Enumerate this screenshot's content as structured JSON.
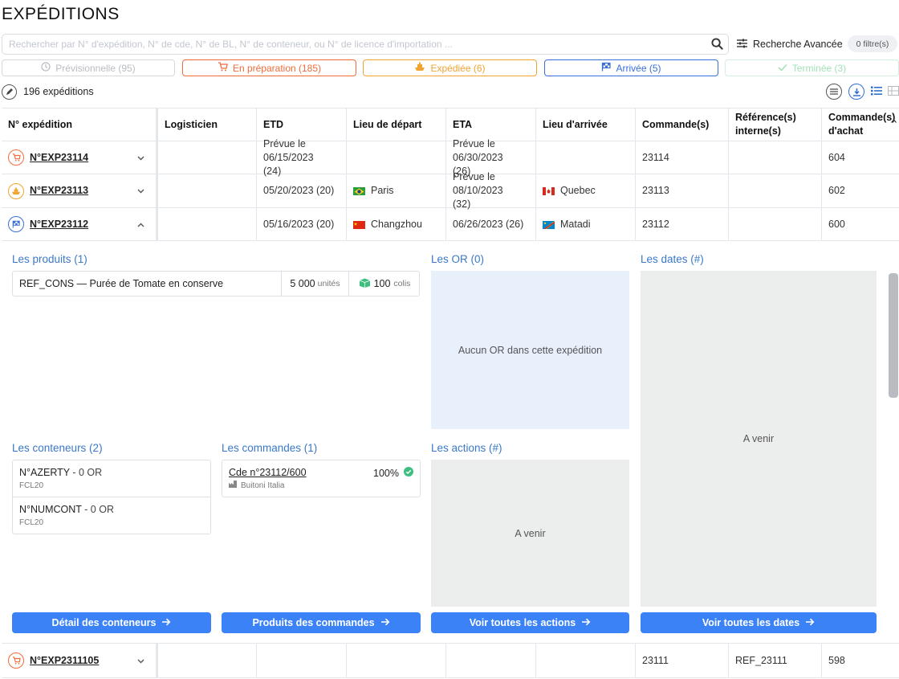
{
  "page": {
    "title": "EXPÉDITIONS"
  },
  "search": {
    "placeholder": "Rechercher par N° d'expédition, N° de cde, N° de BL, N° de conteneur, ou N° de licence d'importation ...",
    "advanced_label": "Recherche Avancée",
    "filter_badge": "0 filtre(s)"
  },
  "status_tabs": [
    {
      "label": "Prévisionnelle (95)",
      "color": "#b9bcc2",
      "icon": "clock-icon"
    },
    {
      "label": "En préparation (185)",
      "color": "#ef6c3a",
      "icon": "cart-icon"
    },
    {
      "label": "Expédiée (6)",
      "color": "#f0a431",
      "icon": "ship-icon"
    },
    {
      "label": "Arrivée (5)",
      "color": "#3a6fd8",
      "icon": "flag-icon"
    },
    {
      "label": "Terminée (3)",
      "color": "#a5dfb9",
      "icon": "check-icon"
    }
  ],
  "summary": {
    "count_label": "196 expéditions"
  },
  "table": {
    "headers": [
      "N° expédition",
      "Logisticien",
      "ETD",
      "Lieu de départ",
      "ETA",
      "Lieu d'arrivée",
      "Commande(s)",
      "Référence(s) interne(s)",
      "Commande(s) d'achat"
    ],
    "rows": [
      {
        "exp": "N°EXP23114",
        "status_icon": "cart-icon",
        "status_color": "#ef6c3a",
        "logisticien": "",
        "etd": "Prévue le 06/15/2023 (24)",
        "depart": "",
        "depart_flag": "",
        "eta": "Prévue le 06/30/2023 (26)",
        "arrivee": "",
        "arrivee_flag": "",
        "commandes": "23114",
        "ref": "",
        "achat": "604",
        "expanded": false
      },
      {
        "exp": "N°EXP23113",
        "status_icon": "ship-icon",
        "status_color": "#f0a431",
        "logisticien": "",
        "etd": "05/20/2023 (20)",
        "depart": "Paris",
        "depart_flag": "brazil-flag",
        "eta": "Prévue le 08/10/2023 (32)",
        "arrivee": "Quebec",
        "arrivee_flag": "canada-flag",
        "commandes": "23113",
        "ref": "",
        "achat": "602",
        "expanded": false
      },
      {
        "exp": "N°EXP23112",
        "status_icon": "flag-icon",
        "status_color": "#3a6fd8",
        "logisticien": "",
        "etd": "05/16/2023 (20)",
        "depart": "Changzhou",
        "depart_flag": "china-flag",
        "eta": "06/26/2023 (26)",
        "arrivee": "Matadi",
        "arrivee_flag": "drc-flag",
        "commandes": "23112",
        "ref": "",
        "achat": "600",
        "expanded": true
      },
      {
        "exp": "N°EXP2311105",
        "status_icon": "cart-icon",
        "status_color": "#ef6c3a",
        "logisticien": "",
        "etd": "",
        "depart": "",
        "depart_flag": "",
        "eta": "",
        "arrivee": "",
        "arrivee_flag": "",
        "commandes": "23111",
        "ref": "REF_23111",
        "achat": "598",
        "expanded": false
      }
    ]
  },
  "detail": {
    "produits": {
      "title": "Les produits (1)",
      "items": [
        {
          "name": "REF_CONS — Purée de Tomate en conserve",
          "qty": "5 000",
          "qty_unit": "unités",
          "colis": "100",
          "colis_unit": "colis"
        }
      ]
    },
    "or": {
      "title": "Les OR (0)",
      "empty": "Aucun OR dans cette expédition"
    },
    "dates": {
      "title": "Les dates (#)",
      "placeholder": "A venir"
    },
    "conteneurs": {
      "title": "Les conteneurs (2)",
      "items": [
        {
          "name": "N°AZERTY",
          "or": " - 0 OR",
          "type": "FCL20"
        },
        {
          "name": "N°NUMCONT",
          "or": " - 0 OR",
          "type": "FCL20"
        }
      ]
    },
    "commandes": {
      "title": "Les commandes (1)",
      "items": [
        {
          "name": "Cde n°23112/600",
          "supplier": "Buitoni Italia",
          "progress": "100%"
        }
      ]
    },
    "actions": {
      "title": "Les actions (#)",
      "placeholder": "A venir"
    },
    "buttons": {
      "conteneurs": "Détail des conteneurs",
      "commandes": "Produits des commandes",
      "actions": "Voir toutes les actions",
      "dates": "Voir toutes les dates"
    }
  },
  "colors": {
    "accent": "#3b82f6",
    "section_title": "#3a78c9"
  }
}
